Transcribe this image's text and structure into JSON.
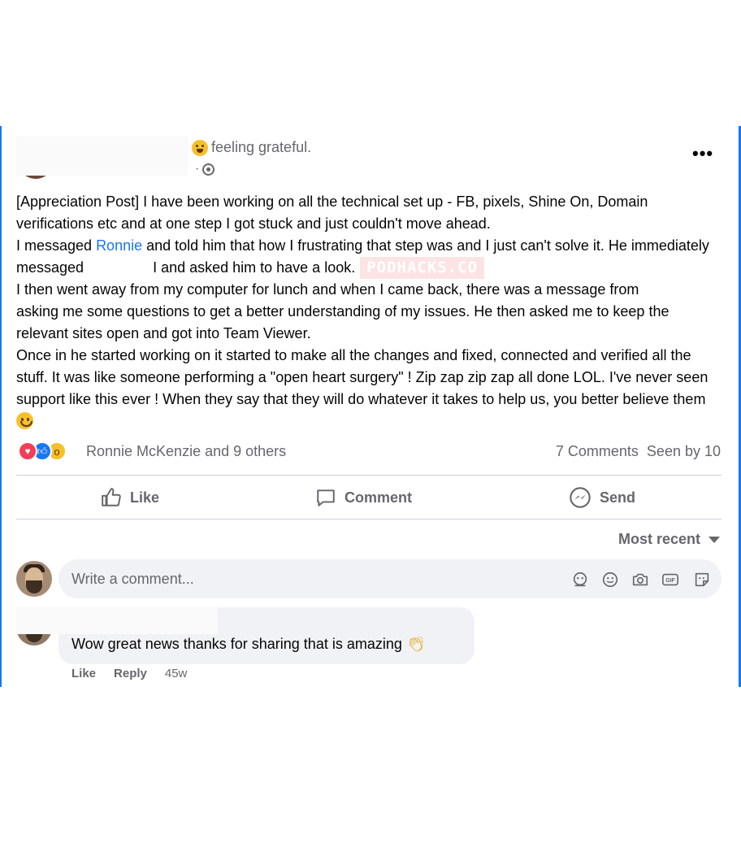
{
  "post": {
    "feeling": "feeling grateful.",
    "meta_dot": "·",
    "more_label": "•••",
    "text": {
      "p1": "[Appreciation Post] I have been working on all the technical set up - FB, pixels, Shine On, Domain verifications etc and at one step I got stuck and just couldn't move ahead.",
      "p2_a": "I messaged ",
      "p2_link": "Ronnie",
      "p2_b": " and told him that how I frustrating that step was and I just can't solve it. He immediately messaged ",
      "p2_c": "I and asked him to have a look.",
      "watermark": "PODHACKS.CO",
      "p3_a": "I then went away from my computer for lunch and when I came back, there was a message from ",
      "p3_b": "asking me some questions to get a better understanding of my issues. He then asked me to keep the relevant sites open and got into Team Viewer.",
      "p4": "Once in he started working on it started to make all the changes and fixed, connected and verified all the stuff. It was like someone performing a \"open heart surgery\" ! Zip zap zip zap all done LOL. I've never seen support like this ever ! When they say that they will do whatever it takes to help us, you better believe them"
    },
    "reactions": {
      "icons": [
        "love-reaction",
        "like-reaction",
        "wow-reaction"
      ],
      "names": "Ronnie McKenzie and 9 others",
      "comments_count": "7 Comments",
      "seen_by": "Seen by 10"
    },
    "actions": {
      "like": "Like",
      "comment": "Comment",
      "send": "Send"
    }
  },
  "comments": {
    "sort_label": "Most recent",
    "input_placeholder": "Write a comment...",
    "input_icons": [
      "avatar-sticker-icon",
      "emoji-icon",
      "camera-icon",
      "gif-icon",
      "sticker-icon"
    ],
    "items": [
      {
        "text": "Wow great news thanks for sharing that is amazing",
        "emoji": "clapping-hands",
        "like": "Like",
        "reply": "Reply",
        "time": "45w"
      }
    ]
  },
  "colors": {
    "accent": "#1877f2",
    "secondary_text": "#65676b",
    "bubble_bg": "#f0f2f5",
    "watermark_bg": "#fde4e4"
  }
}
